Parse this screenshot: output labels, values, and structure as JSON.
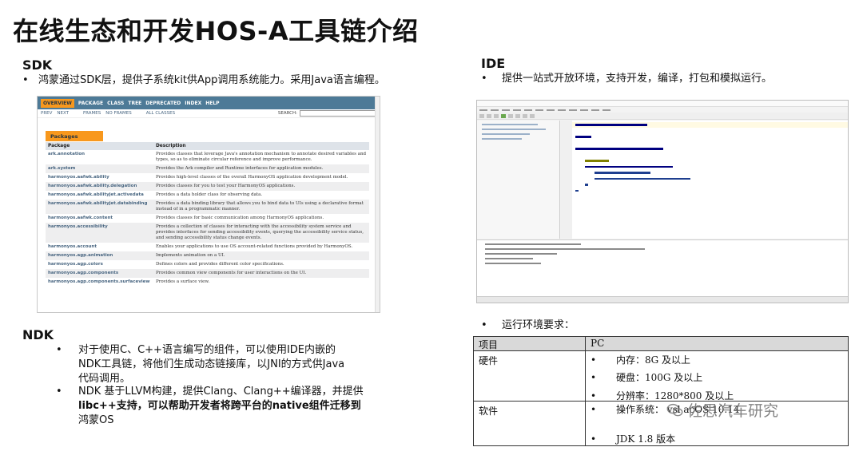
{
  "title": "在线生态和开发HOS-A工具链介绍",
  "sdk": {
    "heading": "SDK",
    "bullet": "鸿蒙通过SDK层，提供子系统kit供App调用系统能力。采用Java语言编程。",
    "doc": {
      "nav": [
        "OVERVIEW",
        "PACKAGE",
        "CLASS",
        "TREE",
        "DEPRECATED",
        "INDEX",
        "HELP"
      ],
      "subnav": [
        "PREV",
        "NEXT",
        "FRAMES",
        "NO FRAMES",
        "ALL CLASSES"
      ],
      "search_label": "SEARCH:",
      "tab": "Packages",
      "columns": [
        "Package",
        "Description"
      ],
      "rows": [
        {
          "pkg": "ark.annotation",
          "desc": "Provides classes that leverage Java's annotation mechanism to annotate desired variables and types, so as to eliminate circular reference and improve performance."
        },
        {
          "pkg": "ark.system",
          "desc": "Provides the Ark compiler and Runtime interfaces for application modules."
        },
        {
          "pkg": "harmonyos.aafwk.ability",
          "desc": "Provides high-level classes of the overall HarmonyOS application development model."
        },
        {
          "pkg": "harmonyos.aafwk.ability.delegation",
          "desc": "Provides classes for you to test your HarmonyOS applications."
        },
        {
          "pkg": "harmonyos.aafwk.abilityjet.activedata",
          "desc": "Provides a data holder class for observing data."
        },
        {
          "pkg": "harmonyos.aafwk.abilityjet.databinding",
          "desc": "Provides a data binding library that allows you to bind data to UIs using a declarative format instead of in a programmatic manner."
        },
        {
          "pkg": "harmonyos.aafwk.content",
          "desc": "Provides classes for basic communication among HarmonyOS applications."
        },
        {
          "pkg": "harmonyos.accessibility",
          "desc": "Provides a collection of classes for interacting with the accessibility system service and provides interfaces for sending accessibility events, querying the accessibility service status, and sending accessibility status change events."
        },
        {
          "pkg": "harmonyos.account",
          "desc": "Enables your applications to use OS account-related functions provided by HarmonyOS."
        },
        {
          "pkg": "harmonyos.agp.animation",
          "desc": "Implements animation on a UI."
        },
        {
          "pkg": "harmonyos.agp.colors",
          "desc": "Defines colors and provides different color specifications."
        },
        {
          "pkg": "harmonyos.agp.components",
          "desc": "Provides common view components for user interactions on the UI."
        },
        {
          "pkg": "harmonyos.agp.components.surfaceview",
          "desc": "Provides a surface view."
        }
      ]
    }
  },
  "ndk": {
    "heading": "NDK",
    "bullets": [
      [
        "对于使用C、C++语言编写的组件，可以使用IDE内嵌的",
        "NDK工具链，将他们生成动态链接库，以JNI的方式供Java",
        "代码调用。"
      ],
      [
        "NDK 基于LLVM构建，提供Clang、Clang++编译器，并提供",
        "libc++支持，可以帮助开发者将跨平台的native组件迁移到",
        "鸿蒙OS"
      ]
    ]
  },
  "ide": {
    "heading": "IDE",
    "bullet": "提供一站式开放环境，支持开发，编译，打包和模拟运行。"
  },
  "env": {
    "bullet": "运行环境要求：",
    "header": {
      "col1": "项目",
      "col2": "PC"
    },
    "hardware": {
      "label": "硬件",
      "items": [
        "内存：8G 及以上",
        "硬盘：100G 及以上",
        "分辨率：1280*800 及以上"
      ]
    },
    "software": {
      "label": "软件",
      "items": [
        "操作系统：    vsl       acOS          10.14",
        "JDK 1.8 版本"
      ]
    }
  },
  "watermark": "佐思汽车研究"
}
